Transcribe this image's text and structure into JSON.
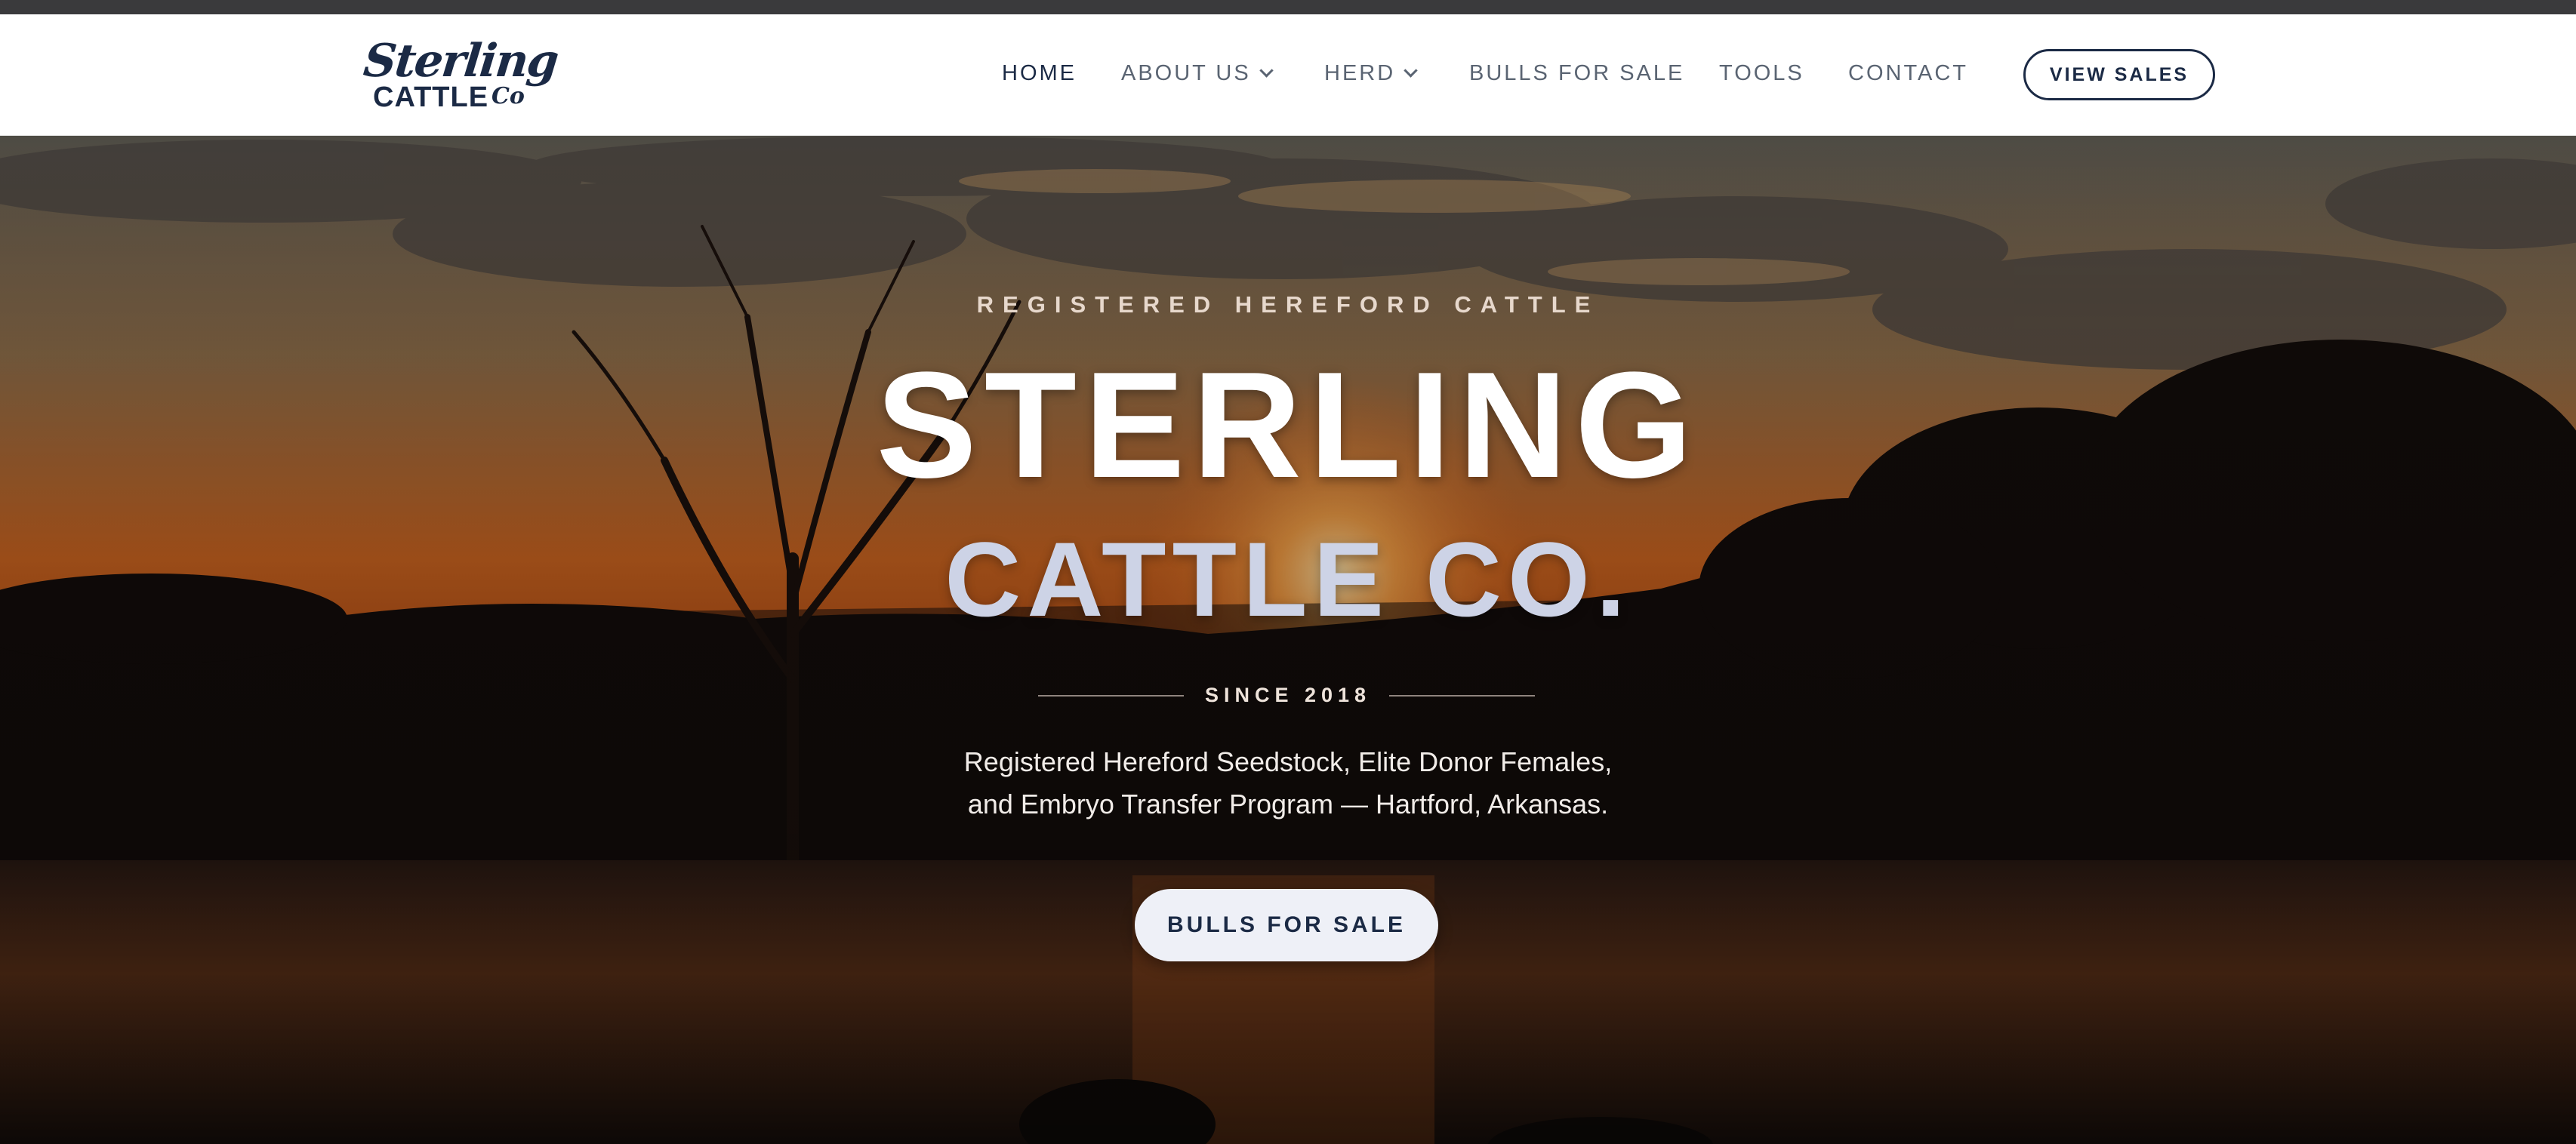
{
  "brand": {
    "logo_script": "Sterling",
    "logo_block": "CATTLE",
    "logo_co": "Co"
  },
  "nav": {
    "items": [
      {
        "label": "HOME",
        "active": true,
        "dropdown": false
      },
      {
        "label": "ABOUT US",
        "active": false,
        "dropdown": true
      },
      {
        "label": "HERD",
        "active": false,
        "dropdown": true
      },
      {
        "label": "BULLS FOR SALE",
        "active": false,
        "dropdown": false
      },
      {
        "label": "TOOLS",
        "active": false,
        "dropdown": false
      },
      {
        "label": "CONTACT",
        "active": false,
        "dropdown": false
      }
    ],
    "cta_label": "VIEW SALES"
  },
  "hero": {
    "eyebrow": "REGISTERED HEREFORD CATTLE",
    "title_line1": "STERLING",
    "title_line2": "CATTLE CO.",
    "since": "SINCE 2018",
    "subtitle_line1": "Registered Hereford Seedstock, Elite Donor Females,",
    "subtitle_line2": "and Embryo Transfer Program — Hartford, Arkansas.",
    "cta_label": "BULLS FOR SALE"
  },
  "colors": {
    "navy": "#1b2a45",
    "nav_text": "#5a6472",
    "sunset_orange": "#d8661e",
    "cta_bg": "#eef0f7"
  }
}
